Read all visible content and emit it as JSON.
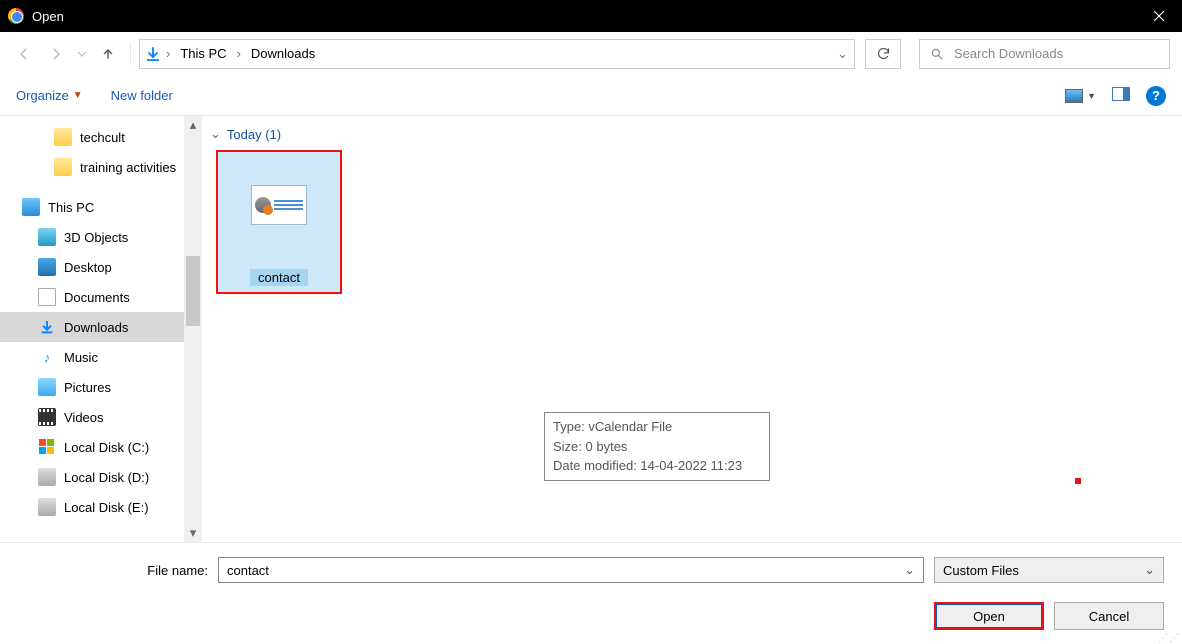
{
  "window": {
    "title": "Open"
  },
  "nav": {
    "breadcrumb": [
      "This PC",
      "Downloads"
    ],
    "search_placeholder": "Search Downloads"
  },
  "toolbar": {
    "organize": "Organize",
    "new_folder": "New folder",
    "help": "?"
  },
  "tree": {
    "items": [
      {
        "label": "techcult",
        "icon": "folder",
        "level": 2
      },
      {
        "label": "training activities",
        "icon": "folder",
        "level": 2
      },
      {
        "label": "This PC",
        "icon": "pc",
        "level": 1
      },
      {
        "label": "3D Objects",
        "icon": "3d",
        "level": 2
      },
      {
        "label": "Desktop",
        "icon": "desktop",
        "level": 2
      },
      {
        "label": "Documents",
        "icon": "doc",
        "level": 2
      },
      {
        "label": "Downloads",
        "icon": "download",
        "level": 2,
        "selected": true
      },
      {
        "label": "Music",
        "icon": "music",
        "level": 2
      },
      {
        "label": "Pictures",
        "icon": "pic",
        "level": 2
      },
      {
        "label": "Videos",
        "icon": "vid",
        "level": 2
      },
      {
        "label": "Local Disk (C:)",
        "icon": "win",
        "level": 2
      },
      {
        "label": "Local Disk (D:)",
        "icon": "disk",
        "level": 2
      },
      {
        "label": "Local Disk (E:)",
        "icon": "disk",
        "level": 2
      }
    ]
  },
  "content": {
    "group_label": "Today (1)",
    "file_name": "contact",
    "tooltip": {
      "line1": "Type: vCalendar File",
      "line2": "Size: 0 bytes",
      "line3": "Date modified: 14-04-2022 11:23"
    }
  },
  "footer": {
    "filename_label": "File name:",
    "filename_value": "contact",
    "filter": "Custom Files",
    "open": "Open",
    "cancel": "Cancel"
  }
}
